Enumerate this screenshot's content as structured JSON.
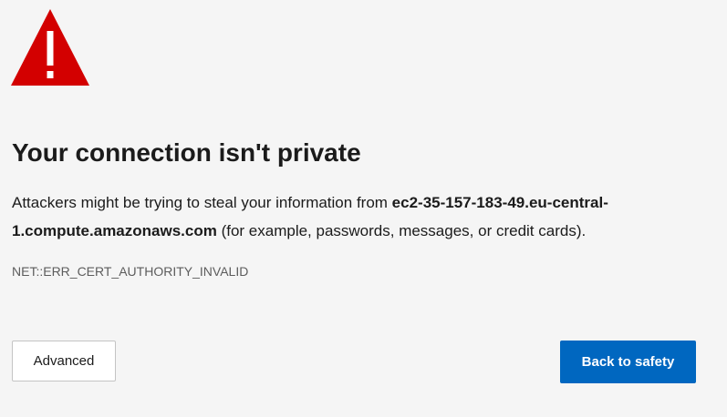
{
  "icon": {
    "name": "warning-icon",
    "color": "#d30000",
    "mark_color": "#ffffff"
  },
  "title": "Your connection isn't private",
  "description": {
    "prefix": "Attackers might be trying to steal your information from ",
    "host": "ec2-35-157-183-49.eu-central-1.compute.amazonaws.com",
    "suffix": " (for example, passwords, messages, or credit cards)."
  },
  "error_code": "NET::ERR_CERT_AUTHORITY_INVALID",
  "buttons": {
    "advanced_label": "Advanced",
    "back_label": "Back to safety"
  },
  "colors": {
    "background": "#f5f5f5",
    "primary_button": "#0067c0"
  }
}
